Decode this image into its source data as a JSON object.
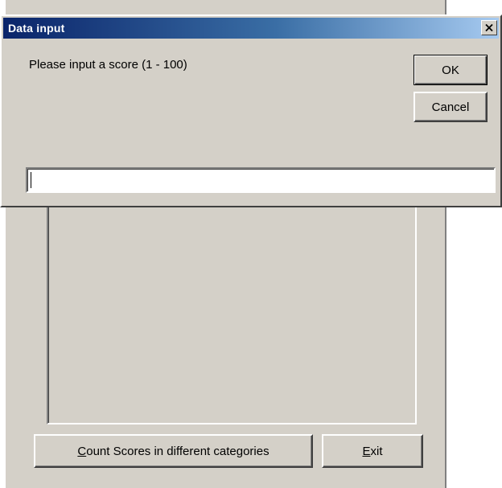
{
  "dialog": {
    "title": "Data input",
    "prompt": "Please input a score (1 - 100)",
    "ok_label": "OK",
    "cancel_label": "Cancel",
    "input_value": "",
    "close_icon": "close-icon"
  },
  "main_window": {
    "count_button": {
      "mnemonic": "C",
      "rest": "ount Scores in different categories"
    },
    "exit_button": {
      "mnemonic": "E",
      "rest": "xit"
    }
  },
  "colors": {
    "face": "#d4d0c8",
    "title_active_start": "#0a246a",
    "title_active_end": "#a6caf0"
  }
}
